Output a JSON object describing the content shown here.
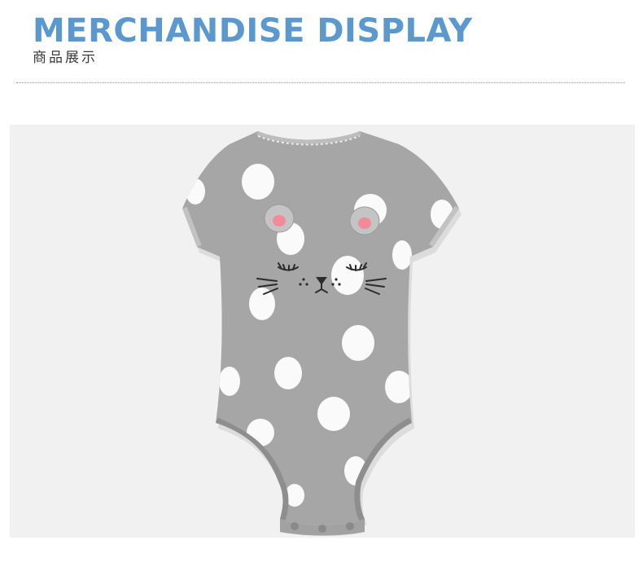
{
  "header": {
    "title": "MERCHANDISE DISPLAY",
    "subtitle": "商品展示"
  },
  "product_image": {
    "subject": "onesie-icon",
    "colors": {
      "background": "#f1f1f1",
      "fabric": "#a6a6a6",
      "dots": "#fafafa",
      "ear_pink": "#f28a9a",
      "title_blue": "#5b98cd"
    }
  }
}
